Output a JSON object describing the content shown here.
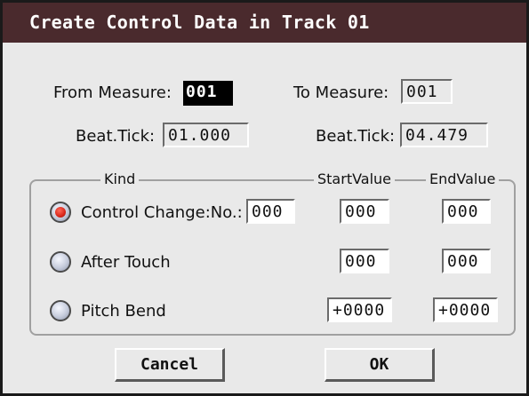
{
  "dialog": {
    "title": "Create Control Data in Track 01"
  },
  "range": {
    "from_measure_label": "From Measure:",
    "from_measure_value": "001",
    "to_measure_label": "To Measure:",
    "to_measure_value": "001",
    "from_beat_label": "Beat.Tick:",
    "from_beat_value": "01.000",
    "to_beat_label": "Beat.Tick:",
    "to_beat_value": "04.479"
  },
  "kind_group": {
    "kind_label": "Kind",
    "start_label": "StartValue",
    "end_label": "EndValue",
    "options": [
      {
        "label": "Control Change:No.:",
        "number": "000",
        "start": "000",
        "end": "000",
        "selected": true
      },
      {
        "label": "After Touch",
        "start": "000",
        "end": "000",
        "selected": false
      },
      {
        "label": "Pitch Bend",
        "start": "+0000",
        "end": "+0000",
        "selected": false
      }
    ]
  },
  "buttons": {
    "cancel_label": "Cancel",
    "ok_label": "OK"
  },
  "colors": {
    "title_bar": "#4a2a2d",
    "dialog_bg": "#e9e9e9",
    "radio_selected": "#d9261a"
  }
}
